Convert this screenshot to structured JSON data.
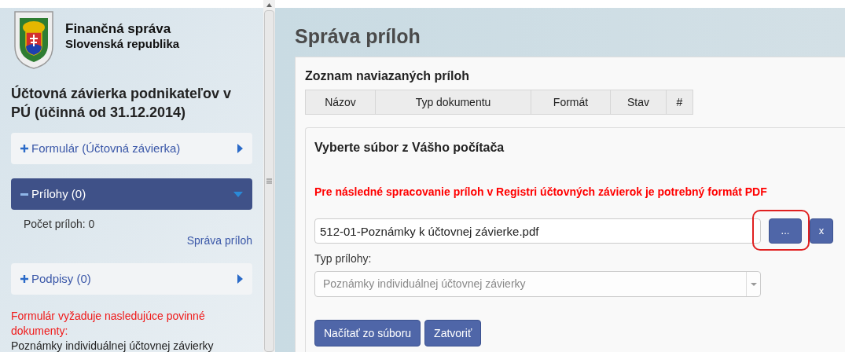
{
  "brand": {
    "title": "Finančná správa",
    "subtitle": "Slovenská republika"
  },
  "sidebar": {
    "heading": "Účtovná závierka podnikateľov v PÚ (účinná od 31.12.2014)",
    "sections": [
      {
        "label": "Formulár (Účtovná závierka)",
        "expanded": false
      },
      {
        "label": "Prílohy (0)",
        "expanded": true,
        "count": "Počet príloh: 0",
        "link": "Správa príloh"
      },
      {
        "label": "Podpisy (0)",
        "expanded": false
      }
    ],
    "warning": "Formulár vyžaduje nasledujúce povinné dokumenty:",
    "required_document": "Poznámky individuálnej účtovnej závierky"
  },
  "page_title": "Správa príloh",
  "attachments": {
    "title": "Zoznam naviazaných príloh",
    "columns": [
      "Názov",
      "Typ dokumentu",
      "Formát",
      "Stav",
      "#"
    ]
  },
  "upload": {
    "title": "Vyberte súbor z Vášho počítača",
    "notice": "Pre následné spracovanie príloh v Registri účtovných závierok je potrebný formát PDF",
    "file_value": "512-01-Poznámky k účtovnej závierke.pdf",
    "file_buttons": [
      {
        "label": "...",
        "highlighted": true
      },
      {
        "label": "x",
        "highlighted": false
      }
    ],
    "type_label": "Typ prílohy:",
    "type_value": "Poznámky individuálnej účtovnej závierky",
    "type_disabled": true,
    "actions": [
      "Načítať zo súboru",
      "Zatvoriť"
    ]
  }
}
